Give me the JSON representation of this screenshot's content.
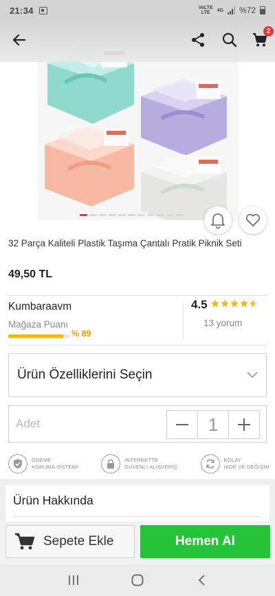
{
  "status_bar": {
    "time": "21:34",
    "network_top": "VoLTE",
    "network_bottom": "LTE",
    "signal_label": "4G",
    "battery": "%72"
  },
  "header": {
    "cart_badge": "2"
  },
  "carousel": {
    "total": 11,
    "active": 0
  },
  "product": {
    "title": "32 Parça Kaliteli Plastik Taşıma Çantalı Pratik Piknik Seti",
    "price": "49,50 TL"
  },
  "seller": {
    "name": "Kumbaraavm",
    "store_label": "Mağaza Puanı",
    "score_percent": "% 89",
    "score_fraction": 0.89,
    "rating": "4.5",
    "rating_value": 4.5,
    "reviews": "13 yorum"
  },
  "options": {
    "feature_select": "Ürün Özelliklerini Seçin",
    "quantity_label": "Adet",
    "quantity": "1"
  },
  "badges": [
    {
      "icon": "shield-check-icon",
      "line1": "ÖDEME",
      "line2": "KORUMA SİSTEMİ"
    },
    {
      "icon": "lock-icon",
      "line1": "İNTERNETTE",
      "line2": "GÜVENLİ ALIŞVERİŞ"
    },
    {
      "icon": "refresh-icon",
      "line1": "KOLAY",
      "line2": "İADE VE DEĞİŞİM"
    }
  ],
  "about": {
    "label": "Ürün Hakkında"
  },
  "actions": {
    "add_to_cart": "Sepete Ekle",
    "buy_now": "Hemen Al"
  },
  "colors": {
    "accent_red": "#e53935",
    "buy_green": "#24c33a",
    "score_yellow": "#f6b60d"
  }
}
